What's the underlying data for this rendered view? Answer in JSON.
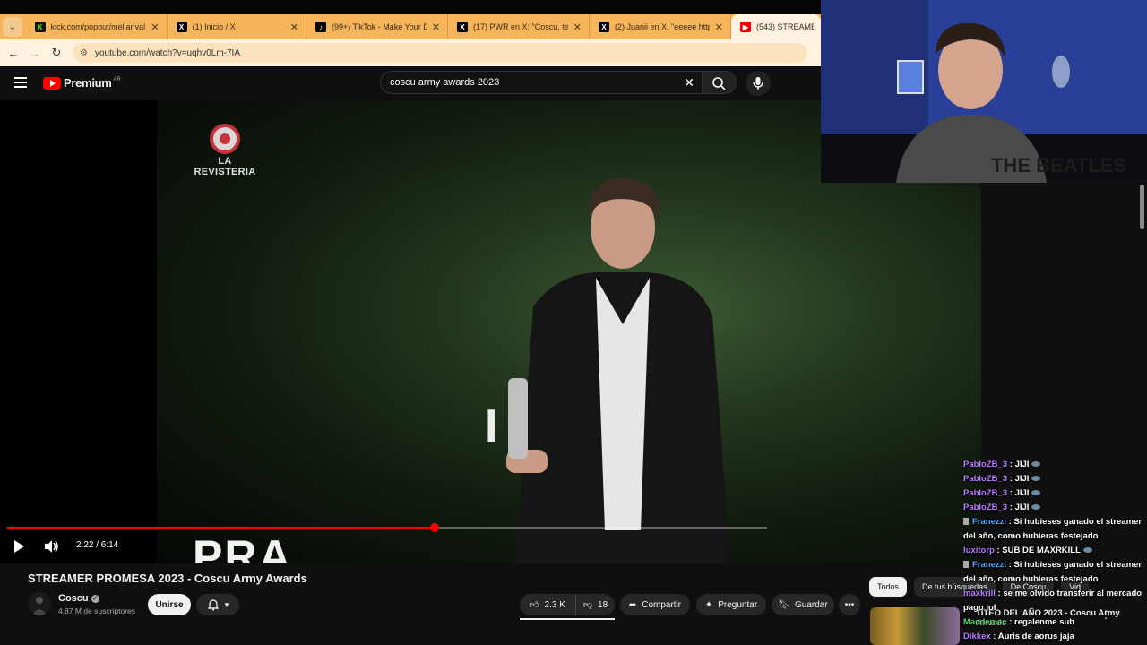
{
  "browser": {
    "tabs": [
      {
        "title": "kick.com/popout/melianvalen/c",
        "favicon": "kick-icon",
        "active": false
      },
      {
        "title": "(1) Inicio / X",
        "favicon": "x-icon",
        "active": false
      },
      {
        "title": "(99+) TikTok - Make Your Day",
        "favicon": "tiktok-icon",
        "active": false
      },
      {
        "title": "(17) PWR en X: \"Coscu, te met",
        "favicon": "x-icon",
        "active": false
      },
      {
        "title": "(2) Juanii en X: \"eeeee https://t",
        "favicon": "x-icon",
        "active": false
      },
      {
        "title": "(543) STREAMER PRO",
        "favicon": "youtube-icon",
        "active": true
      }
    ],
    "url": "youtube.com/watch?v=uqhv0Lm-7IA"
  },
  "youtube": {
    "logo_text": "Premium",
    "country": "AR",
    "search_value": "coscu army awards 2023"
  },
  "video": {
    "watermark": "LA REVISTERIA",
    "sign_text": "I AN",
    "bottom_text": "PRA",
    "time_current": "2:22",
    "time_total": "6:14",
    "time_display": "2:22 / 6:14",
    "progress": 0.562,
    "title": "STREAMER PROMESA 2023 - Coscu Army Awards"
  },
  "channel": {
    "name": "Coscu",
    "subscribers": "4.87 M de suscriptores",
    "join_label": "Unirse"
  },
  "actions": {
    "likes": "2.3 K",
    "dislikes": "18",
    "share": "Compartir",
    "ask": "Preguntar",
    "save": "Guardar"
  },
  "sidebar": {
    "chips": [
      "Todos",
      "De tus búsquedas",
      "De Coscu",
      "Vid"
    ],
    "related_title": "TITEO DEL AÑO 2023 - Coscu Army Awards"
  },
  "chat": [
    {
      "user": "PabloZB_3",
      "text": "JIJI",
      "color": "purple",
      "emote": true
    },
    {
      "user": "PabloZB_3",
      "text": "JIJI",
      "color": "purple",
      "emote": true
    },
    {
      "user": "PabloZB_3",
      "text": "JIJI",
      "color": "purple",
      "emote": true
    },
    {
      "user": "PabloZB_3",
      "text": "JIJI",
      "color": "purple",
      "emote": true
    },
    {
      "user": "Franezzi",
      "text": "Si hubieses ganado el streamer del año, como hubieras festejado",
      "color": "blue",
      "emote": false
    },
    {
      "user": "luxitorp",
      "text": "SUB DE MAXRKILL",
      "color": "purple",
      "emote": true
    },
    {
      "user": "Franezzi",
      "text": "Si hubieses ganado el streamer del año, como hubieras festejado",
      "color": "blue",
      "emote": false
    },
    {
      "user": "maxkrill",
      "text": "se me olvido transferir al mercado pago lol",
      "color": "purple",
      "emote": false
    },
    {
      "user": "Macdemac",
      "text": "regalenme sub",
      "color": "green",
      "emote": false
    },
    {
      "user": "Dikkex",
      "text": "Auris de aorus jaja",
      "color": "purple",
      "emote": false
    }
  ],
  "colors": {
    "tab_strip": "#f6b45b",
    "yt_red": "#ff0000",
    "background": "#0f0f0f"
  }
}
